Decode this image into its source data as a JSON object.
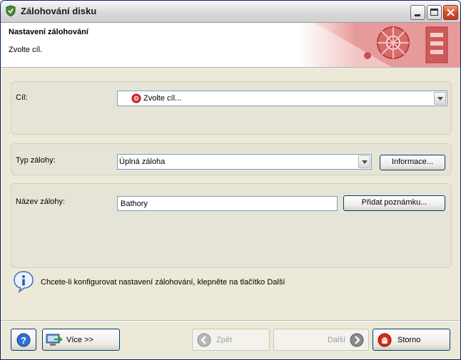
{
  "window": {
    "title": "Zálohování disku"
  },
  "header": {
    "title": "Nastavení zálohování",
    "subtitle": "Zvolte cíl."
  },
  "destination": {
    "label": "Cíl:",
    "value": "Zvolte cíl..."
  },
  "backup_type": {
    "label": "Typ zálohy:",
    "value": "Úplná záloha",
    "info_button": "Informace..."
  },
  "backup_name": {
    "label": "Název zálohy:",
    "value": "Bathory",
    "note_button": "Přidat poznámku..."
  },
  "info": {
    "message": "Chcete-li konfigurovat nastavení zálohování, klepněte na tlačítko Další"
  },
  "footer": {
    "more_label": "Více >>",
    "back_label": "Zpět",
    "next_label": "Další",
    "cancel_label": "Storno"
  }
}
